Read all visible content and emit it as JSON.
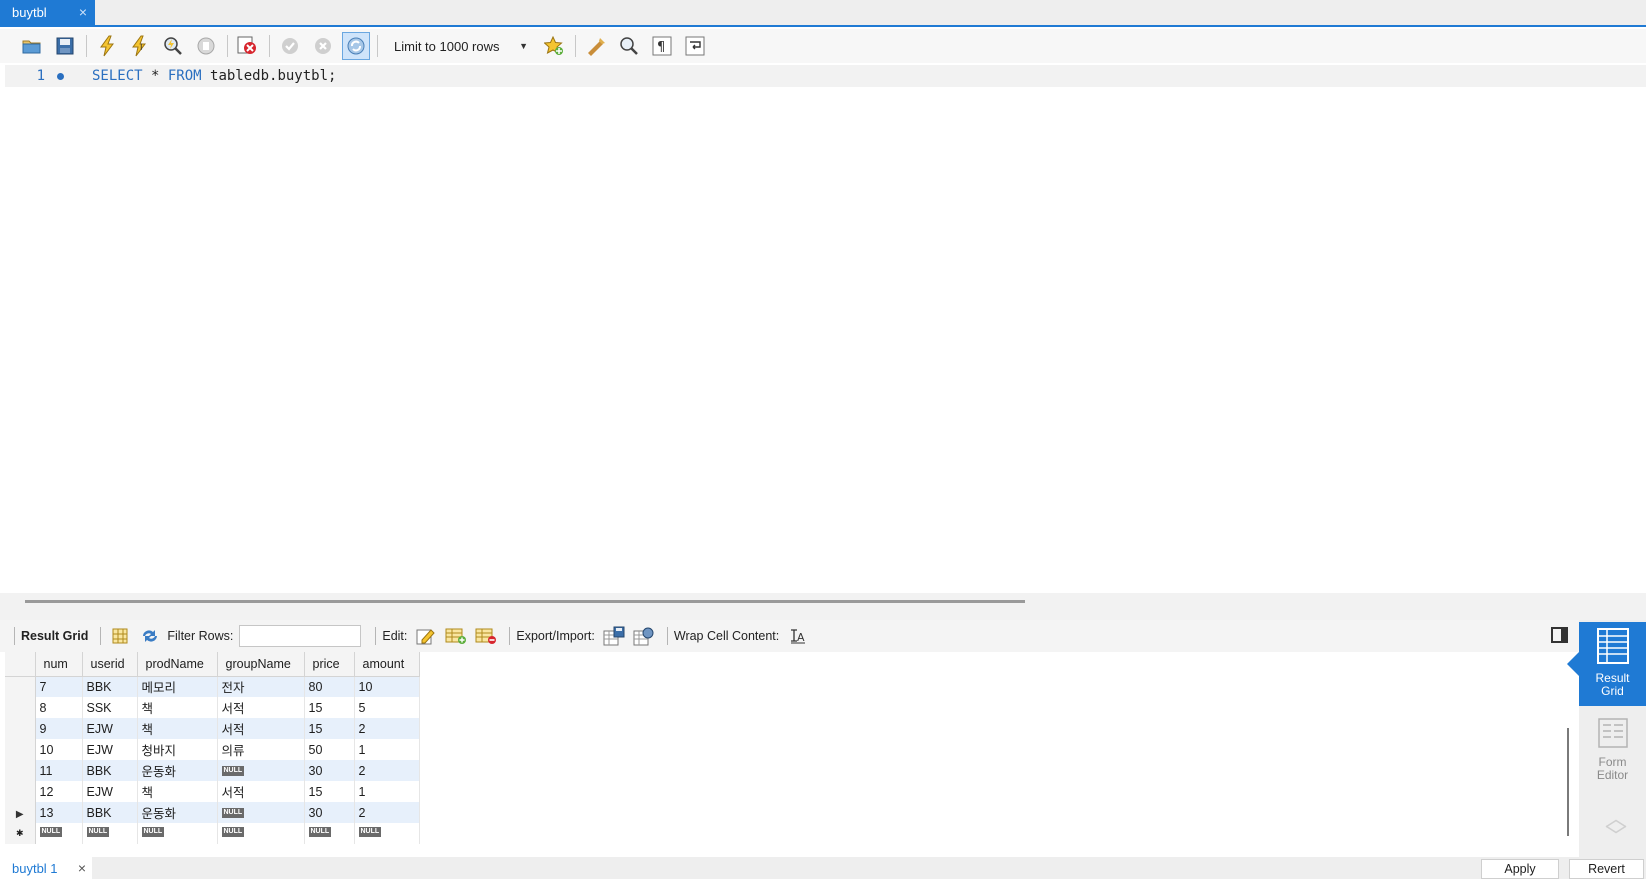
{
  "tab": {
    "title": "buytbl",
    "close": "×"
  },
  "toolbar": {
    "limit_label": "Limit to 1000 rows"
  },
  "editor": {
    "line_number": "1",
    "sql_kw1": "SELECT",
    "sql_star": " * ",
    "sql_kw2": "FROM",
    "sql_rest": " tabledb.buytbl;"
  },
  "result_toolbar": {
    "result_grid": "Result Grid",
    "filter_rows": "Filter Rows:",
    "edit": "Edit:",
    "export_import": "Export/Import:",
    "wrap_cell": "Wrap Cell Content:"
  },
  "grid": {
    "columns": [
      "num",
      "userid",
      "prodName",
      "groupName",
      "price",
      "amount"
    ],
    "null_text": "NULL",
    "rows": [
      [
        "7",
        "BBK",
        "메모리",
        "전자",
        "80",
        "10"
      ],
      [
        "8",
        "SSK",
        "책",
        "서적",
        "15",
        "5"
      ],
      [
        "9",
        "EJW",
        "책",
        "서적",
        "15",
        "2"
      ],
      [
        "10",
        "EJW",
        "청바지",
        "의류",
        "50",
        "1"
      ],
      [
        "11",
        "BBK",
        "운동화",
        "NULL",
        "30",
        "2"
      ],
      [
        "12",
        "EJW",
        "책",
        "서적",
        "15",
        "1"
      ],
      [
        "13",
        "BBK",
        "운동화",
        "NULL",
        "30",
        "2"
      ]
    ],
    "new_row_marker": "✱"
  },
  "side_panel": {
    "result_grid_line1": "Result",
    "result_grid_line2": "Grid",
    "form_editor_line1": "Form",
    "form_editor_line2": "Editor"
  },
  "bottom": {
    "result_tab": "buytbl 1",
    "close": "×",
    "apply": "Apply",
    "revert": "Revert"
  },
  "colors": {
    "accent": "#1f7ad4"
  }
}
